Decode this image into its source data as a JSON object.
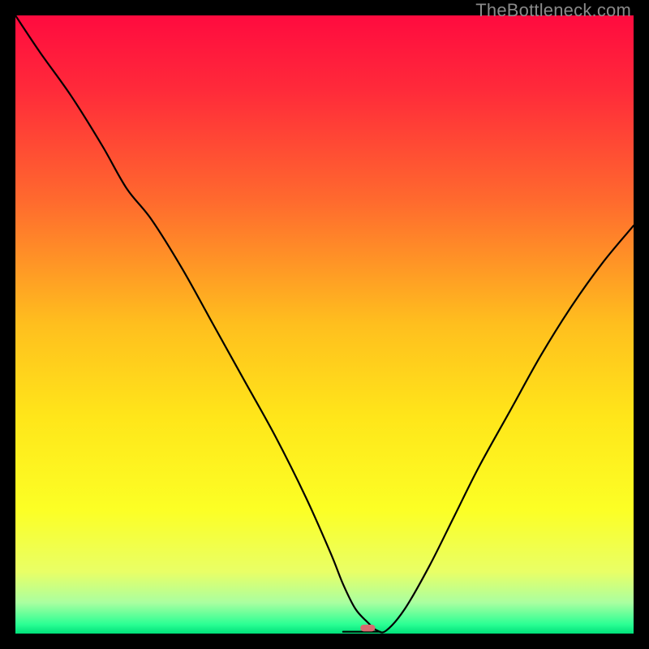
{
  "watermark": "TheBottleneck.com",
  "chart_data": {
    "type": "line",
    "title": "",
    "xlabel": "",
    "ylabel": "",
    "xlim": [
      0,
      100
    ],
    "ylim": [
      0,
      100
    ],
    "grid": false,
    "legend": false,
    "background": {
      "kind": "vertical-gradient",
      "stops": [
        {
          "pos": 0.0,
          "color": "#ff0b3f"
        },
        {
          "pos": 0.12,
          "color": "#ff2a3a"
        },
        {
          "pos": 0.3,
          "color": "#ff6a2e"
        },
        {
          "pos": 0.5,
          "color": "#ffbf1e"
        },
        {
          "pos": 0.65,
          "color": "#ffe61a"
        },
        {
          "pos": 0.8,
          "color": "#fcff25"
        },
        {
          "pos": 0.9,
          "color": "#e9ff66"
        },
        {
          "pos": 0.95,
          "color": "#aaffa0"
        },
        {
          "pos": 0.985,
          "color": "#2bff94"
        },
        {
          "pos": 1.0,
          "color": "#00e07a"
        }
      ]
    },
    "series": [
      {
        "name": "bottleneck-curve",
        "color": "#000000",
        "x": [
          0,
          4,
          9,
          14,
          18,
          22,
          27,
          32,
          37,
          42,
          47,
          51,
          53,
          55,
          57,
          58.5,
          60,
          63,
          67,
          71,
          75,
          80,
          85,
          90,
          95,
          100
        ],
        "y": [
          100,
          94,
          87,
          79,
          72,
          67,
          59,
          50,
          41,
          32,
          22,
          13,
          8,
          4,
          1.8,
          0.5,
          0.5,
          4,
          11,
          19,
          27,
          36,
          45,
          53,
          60,
          66
        ]
      }
    ],
    "flat_segment": {
      "x_start": 53,
      "x_end": 59,
      "y": 0.3
    },
    "marker": {
      "shape": "pill",
      "x": 57.0,
      "y": 0.9,
      "width_pct": 2.4,
      "height_pct": 1.1,
      "color": "#d66a6f"
    }
  }
}
